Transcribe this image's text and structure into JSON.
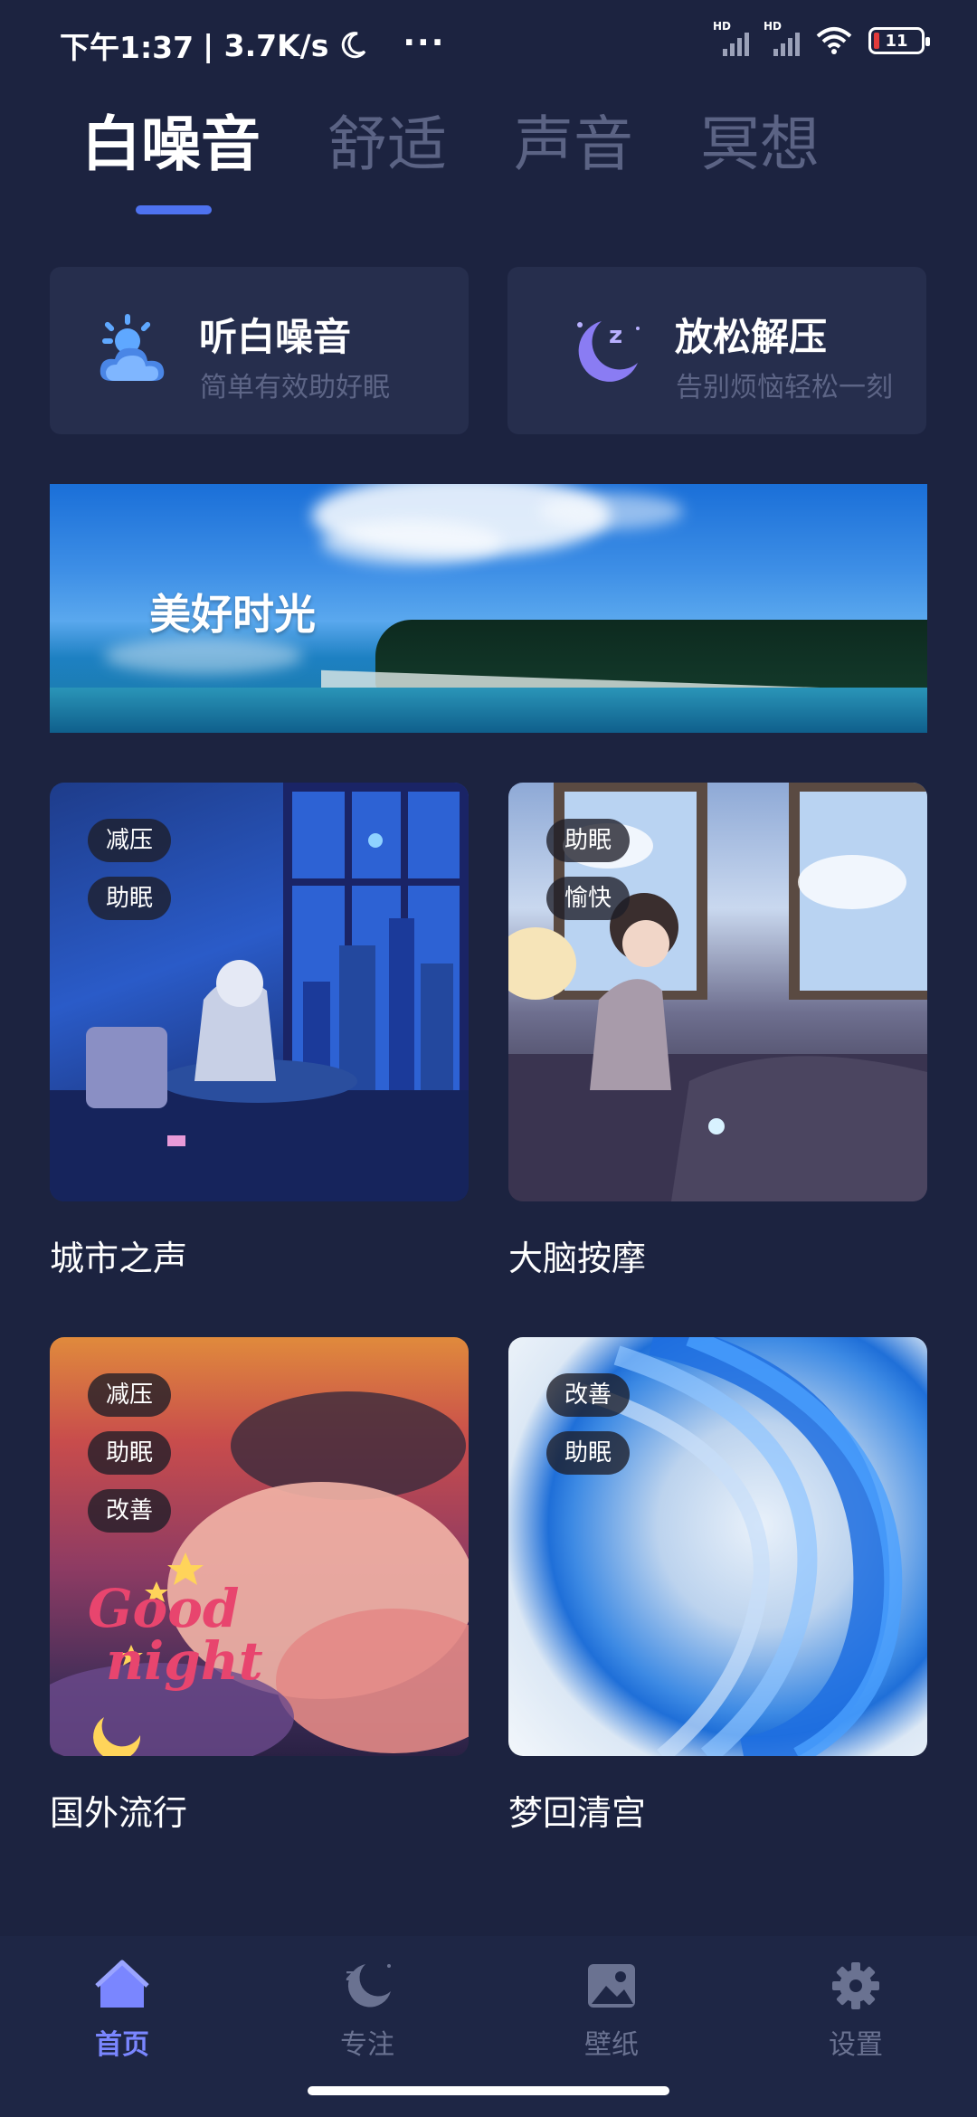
{
  "status_bar": {
    "time": "下午1:37",
    "speed": "| 3.7K/s",
    "more": "···",
    "signal1_label": "HD",
    "signal2_label": "HD",
    "battery_level": "11"
  },
  "tabs": [
    {
      "label": "白噪音",
      "active": true
    },
    {
      "label": "舒适",
      "active": false
    },
    {
      "label": "声音",
      "active": false
    },
    {
      "label": "冥想",
      "active": false
    }
  ],
  "feature_cards": [
    {
      "title": "听白噪音",
      "subtitle": "简单有效助好眠",
      "icon": "weather-icon"
    },
    {
      "title": "放松解压",
      "subtitle": "告别烦恼轻松一刻",
      "icon": "sleep-moon-icon"
    }
  ],
  "banner": {
    "title": "美好时光"
  },
  "grid": [
    {
      "title": "城市之声",
      "tags": [
        "减压",
        "助眠"
      ]
    },
    {
      "title": "大脑按摩",
      "tags": [
        "助眠",
        "愉快"
      ]
    },
    {
      "title": "国外流行",
      "tags": [
        "减压",
        "助眠",
        "改善"
      ]
    },
    {
      "title": "梦回清宫",
      "tags": [
        "改善",
        "助眠"
      ]
    }
  ],
  "artwork_text": {
    "good": "Good",
    "night": "night"
  },
  "bottom_nav": [
    {
      "label": "首页",
      "icon": "home-icon",
      "active": true
    },
    {
      "label": "专注",
      "icon": "focus-moon-icon",
      "active": false
    },
    {
      "label": "壁纸",
      "icon": "wallpaper-icon",
      "active": false
    },
    {
      "label": "设置",
      "icon": "gear-icon",
      "active": false
    }
  ],
  "colors": {
    "background": "#1c2340",
    "accent": "#4e72f0",
    "nav_active": "#7a86ff",
    "card": "#262e4d"
  }
}
